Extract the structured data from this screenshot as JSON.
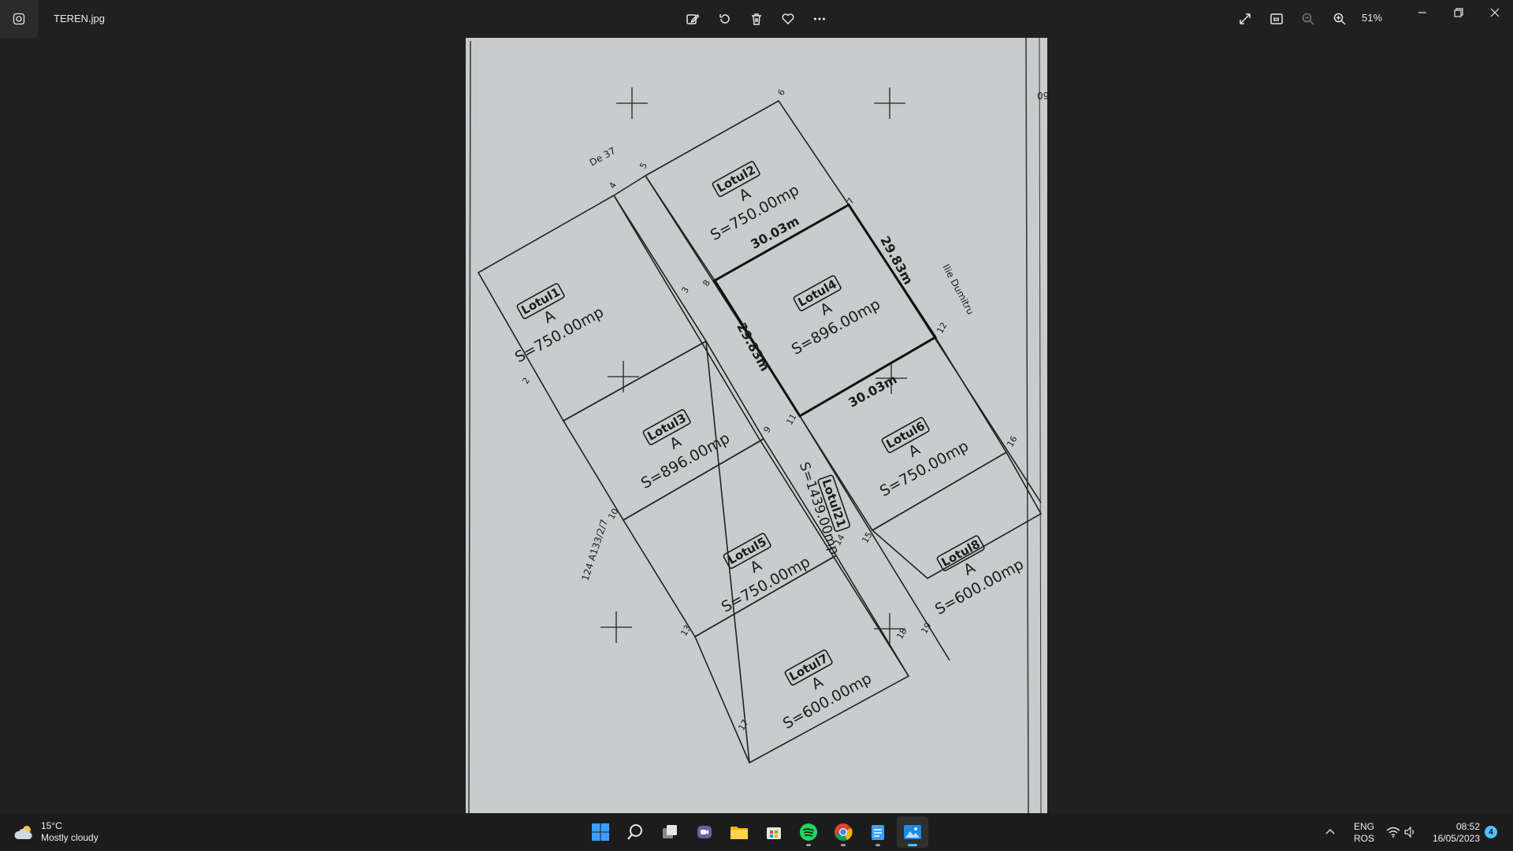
{
  "window": {
    "file_name": "TEREN.jpg",
    "zoom_level": "51%",
    "toolbar_icons": [
      "edit-image-icon",
      "rotate-icon",
      "delete-icon",
      "favorite-icon",
      "more-icon"
    ],
    "view_icons": [
      "fullscreen-icon",
      "actual-size-icon",
      "zoom-out-icon",
      "zoom-in-icon"
    ]
  },
  "plan": {
    "road_label": "De 37",
    "parcel_ref": "124 A133/2/7",
    "street_label": "Ilie Dumitru",
    "edge_left_label": "29.83m",
    "edge_right_label": "29.83m",
    "edge_top_label": "30.03m",
    "edge_bottom_label": "30.03m",
    "lots": [
      {
        "name": "Lotul1",
        "category": "A",
        "area": "S=750.00mp"
      },
      {
        "name": "Lotul2",
        "category": "A",
        "area": "S=750.00mp"
      },
      {
        "name": "Lotul3",
        "category": "A",
        "area": "S=896.00mp"
      },
      {
        "name": "Lotul4",
        "category": "A",
        "area": "S=896.00mp"
      },
      {
        "name": "Lotul5",
        "category": "A",
        "area": "S=750.00mp"
      },
      {
        "name": "Lotul6",
        "category": "A",
        "area": "S=750.00mp"
      },
      {
        "name": "Lotul7",
        "category": "A",
        "area": "S=600.00mp"
      },
      {
        "name": "Lotul8",
        "category": "A",
        "area": "S=600.00mp"
      }
    ],
    "road_lot": {
      "name": "Lotul21",
      "area": "S=1439.00mp"
    },
    "point_numbers": [
      "2",
      "3",
      "4",
      "5",
      "6",
      "7",
      "8",
      "9",
      "10",
      "11",
      "12",
      "13",
      "14",
      "15",
      "16",
      "17",
      "18",
      "19"
    ],
    "edge_fragment": "09"
  },
  "taskbar": {
    "weather_temp": "15°C",
    "weather_desc": "Mostly cloudy",
    "apps": [
      "start-icon",
      "search-icon",
      "task-view-icon",
      "chat-icon",
      "file-explorer-icon",
      "store-icon",
      "spotify-icon",
      "chrome-icon",
      "notepad-icon",
      "photos-icon"
    ],
    "lang_1": "ENG",
    "lang_2": "ROS",
    "time": "08:52",
    "date": "16/05/2023",
    "notification_count": "4"
  }
}
